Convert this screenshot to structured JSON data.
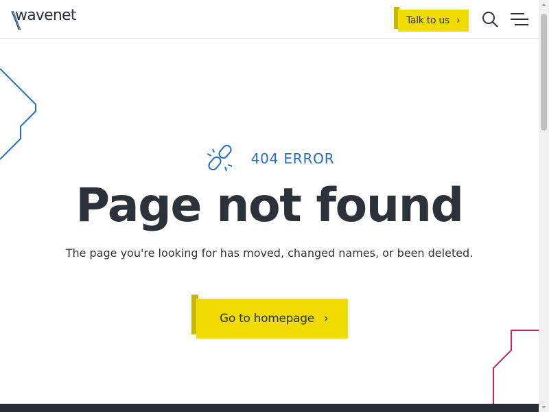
{
  "header": {
    "logo_text": "wavenet",
    "talk_label": "Talk to us",
    "talk_chevron": "›",
    "search_icon": "search-icon",
    "menu_icon": "hamburger-menu-icon"
  },
  "main": {
    "error_code": "404 ERROR",
    "error_icon": "broken-link-icon",
    "title": "Page not found",
    "subtitle": "The page you're looking for has moved, changed names, or been deleted.",
    "home_label": "Go to homepage",
    "home_chevron": "›"
  },
  "colors": {
    "brand_yellow": "#f0dc00",
    "accent_blue": "#1f6fc4",
    "text_dark": "#2c323a",
    "deco_pink": "#d0215f"
  }
}
